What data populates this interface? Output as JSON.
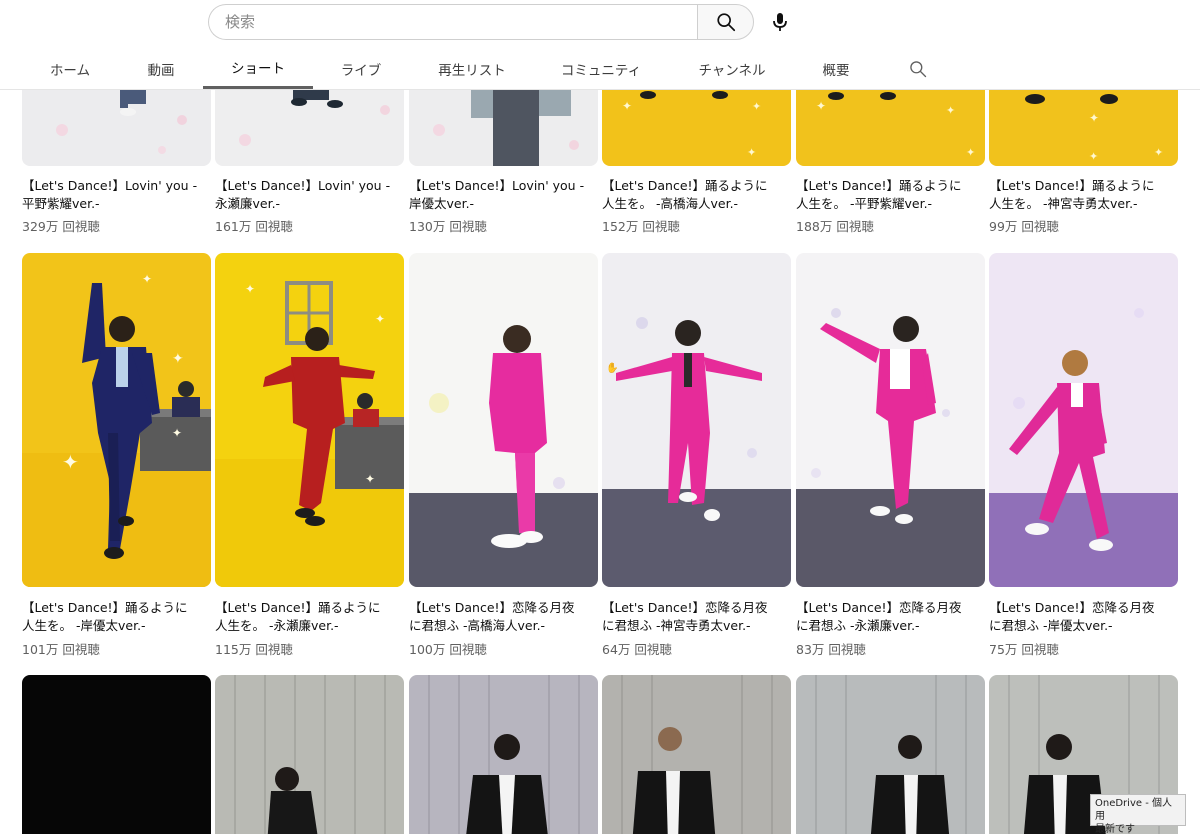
{
  "search": {
    "placeholder": "検索"
  },
  "tabs": [
    {
      "label": "ホーム"
    },
    {
      "label": "動画"
    },
    {
      "label": "ショート"
    },
    {
      "label": "ライブ"
    },
    {
      "label": "再生リスト"
    },
    {
      "label": "コミュニティ"
    },
    {
      "label": "チャンネル"
    },
    {
      "label": "概要"
    }
  ],
  "icons": {
    "search_button": "search-icon",
    "mic_button": "mic-icon",
    "tab_search": "search-icon"
  },
  "rows": [
    {
      "items": [
        {
          "title1": "【Let's Dance!】Lovin' you -",
          "title2": "平野紫耀ver.-",
          "views": "329万 回視聴",
          "theme": "white"
        },
        {
          "title1": "【Let's Dance!】Lovin' you -",
          "title2": "永瀬廉ver.-",
          "views": "161万 回視聴",
          "theme": "white"
        },
        {
          "title1": "【Let's Dance!】Lovin' you -",
          "title2": "岸優太ver.-",
          "views": "130万 回視聴",
          "theme": "white"
        },
        {
          "title1": "【Let's Dance!】踊るように",
          "title2": "人生を。 -高橋海人ver.-",
          "views": "152万 回視聴",
          "theme": "yellow"
        },
        {
          "title1": "【Let's Dance!】踊るように",
          "title2": "人生を。 -平野紫耀ver.-",
          "views": "188万 回視聴",
          "theme": "yellow"
        },
        {
          "title1": "【Let's Dance!】踊るように",
          "title2": "人生を。 -神宮寺勇太ver.-",
          "views": "99万 回視聴",
          "theme": "yellow"
        }
      ]
    },
    {
      "items": [
        {
          "title1": "【Let's Dance!】踊るように",
          "title2": "人生を。 -岸優太ver.-",
          "views": "101万 回視聴",
          "theme": "yellow-navy"
        },
        {
          "title1": "【Let's Dance!】踊るように",
          "title2": "人生を。 -永瀬廉ver.-",
          "views": "115万 回視聴",
          "theme": "yellow-red"
        },
        {
          "title1": "【Let's Dance!】恋降る月夜",
          "title2": "に君想ふ -高橋海人ver.-",
          "views": "100万 回視聴",
          "theme": "pink"
        },
        {
          "title1": "【Let's Dance!】恋降る月夜",
          "title2": "に君想ふ -神宮寺勇太ver.-",
          "views": "64万 回視聴",
          "theme": "pink"
        },
        {
          "title1": "【Let's Dance!】恋降る月夜",
          "title2": "に君想ふ -永瀬廉ver.-",
          "views": "83万 回視聴",
          "theme": "pink"
        },
        {
          "title1": "【Let's Dance!】恋降る月夜",
          "title2": "に君想ふ -岸優太ver.-",
          "views": "75万 回視聴",
          "theme": "pink-purple"
        }
      ]
    },
    {
      "items": [
        {
          "theme": "black"
        },
        {
          "theme": "gray"
        },
        {
          "theme": "gray"
        },
        {
          "theme": "gray"
        },
        {
          "theme": "gray"
        },
        {
          "theme": "gray"
        }
      ]
    }
  ],
  "onedrive": {
    "line1": "OneDrive - 個人用",
    "line2": "最新です"
  }
}
